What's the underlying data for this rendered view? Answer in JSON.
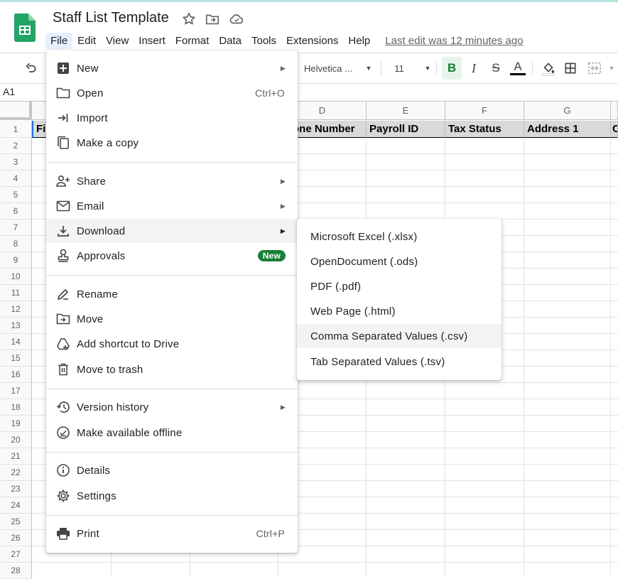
{
  "doc": {
    "title": "Staff List Template",
    "last_edit": "Last edit was 12 minutes ago"
  },
  "menubar": [
    "File",
    "Edit",
    "View",
    "Insert",
    "Format",
    "Data",
    "Tools",
    "Extensions",
    "Help"
  ],
  "toolbar": {
    "font": "Helvetica ...",
    "font_size": "11",
    "bold": "B",
    "italic": "I",
    "strike": "S",
    "text_color": "A"
  },
  "name_box": "A1",
  "columns": [
    "D",
    "E",
    "F",
    "G"
  ],
  "rows": [
    "1",
    "2",
    "3",
    "4",
    "5",
    "6",
    "7",
    "8",
    "9",
    "10",
    "11",
    "12",
    "13",
    "14",
    "15",
    "16",
    "17",
    "18",
    "19",
    "20",
    "21",
    "22",
    "23",
    "24",
    "25",
    "26",
    "27",
    "28"
  ],
  "header_cells": {
    "a": "Fi",
    "d": "one Number",
    "e": "Payroll ID",
    "f": "Tax Status",
    "g": "Address 1",
    "h": "C"
  },
  "file_menu": {
    "items": [
      {
        "label": "New",
        "icon": "plus-box-icon"
      },
      {
        "label": "Open",
        "icon": "folder-icon",
        "shortcut": "Ctrl+O"
      },
      {
        "label": "Import",
        "icon": "import-icon"
      },
      {
        "label": "Make a copy",
        "icon": "copy-icon"
      },
      {
        "label": "Share",
        "icon": "person-add-icon"
      },
      {
        "label": "Email",
        "icon": "mail-icon"
      },
      {
        "label": "Download",
        "icon": "download-icon"
      },
      {
        "label": "Approvals",
        "icon": "stamp-icon",
        "badge": "New"
      },
      {
        "label": "Rename",
        "icon": "pencil-icon"
      },
      {
        "label": "Move",
        "icon": "folder-move-icon"
      },
      {
        "label": "Add shortcut to Drive",
        "icon": "drive-shortcut-icon"
      },
      {
        "label": "Move to trash",
        "icon": "trash-icon"
      },
      {
        "label": "Version history",
        "icon": "history-icon"
      },
      {
        "label": "Make available offline",
        "icon": "offline-check-icon"
      },
      {
        "label": "Details",
        "icon": "info-icon"
      },
      {
        "label": "Settings",
        "icon": "gear-icon"
      },
      {
        "label": "Print",
        "icon": "printer-icon",
        "shortcut": "Ctrl+P"
      }
    ]
  },
  "download_menu": {
    "items": [
      "Microsoft Excel (.xlsx)",
      "OpenDocument (.ods)",
      "PDF (.pdf)",
      "Web Page (.html)",
      "Comma Separated Values (.csv)",
      "Tab Separated Values (.tsv)"
    ]
  },
  "colors": {
    "accent_green": "#188038",
    "highlight": "#f1f3f4",
    "active_menu": "#e8f0fe"
  }
}
